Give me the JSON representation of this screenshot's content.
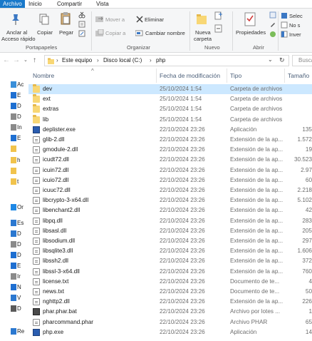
{
  "tabs": {
    "archivo": "Archivo",
    "inicio": "Inicio",
    "compartir": "Compartir",
    "vista": "Vista"
  },
  "ribbon": {
    "anclar": "Anclar al",
    "anclar2": "Acceso rápido",
    "copiar": "Copiar",
    "pegar": "Pegar",
    "mover_a": "Mover a",
    "copiar_a": "Copiar a",
    "eliminar": "Eliminar",
    "cambiar_nombre": "Cambiar nombre",
    "nueva": "Nueva",
    "carpeta": "carpeta",
    "propiedades": "Propiedades",
    "selec": "Selec",
    "no_s": "No s",
    "inver": "Inver",
    "groups": {
      "portapapeles": "Portapapeles",
      "organizar": "Organizar",
      "nuevo": "Nuevo",
      "abrir": "Abrir"
    }
  },
  "address": {
    "crumbs": [
      "Este equipo",
      "Disco local (C:)",
      "php"
    ],
    "search_placeholder": "Busca"
  },
  "nav": {
    "items": [
      {
        "label": "Ac",
        "color": "#3a8fd9"
      },
      {
        "label": "E",
        "color": "#1e6fd1"
      },
      {
        "label": "D",
        "color": "#1e6fd1"
      },
      {
        "label": "D",
        "color": "#8a8a8a"
      },
      {
        "label": "In",
        "color": "#8a8a8a"
      },
      {
        "label": "E",
        "color": "#1e6fd1"
      },
      {
        "label": "",
        "color": "#f1c34c"
      },
      {
        "label": "h",
        "color": "#f1c34c"
      },
      {
        "label": "",
        "color": "#f1c34c"
      },
      {
        "label": "t",
        "color": "#f1c34c"
      },
      {
        "label": "Or",
        "color": "#1e88e5"
      },
      {
        "label": "Es",
        "color": "#2b78d0"
      },
      {
        "label": "D",
        "color": "#2b78d0"
      },
      {
        "label": "D",
        "color": "#8a8a8a"
      },
      {
        "label": "D",
        "color": "#1e6fd1"
      },
      {
        "label": "E",
        "color": "#1e6fd1"
      },
      {
        "label": "Ir",
        "color": "#8a8a8a"
      },
      {
        "label": "N",
        "color": "#1e6fd1"
      },
      {
        "label": "V",
        "color": "#2b78d0"
      },
      {
        "label": "D",
        "color": "#5a5a5a"
      },
      {
        "label": "Re",
        "color": "#2b78d0"
      }
    ]
  },
  "columns": {
    "nombre": "Nombre",
    "fecha": "Fecha de modificación",
    "tipo": "Tipo",
    "tamano": "Tamaño"
  },
  "files": [
    {
      "name": "dev",
      "date": "25/10/2024 1:54",
      "type": "Carpeta de archivos",
      "size": "",
      "kind": "folder",
      "selected": true
    },
    {
      "name": "ext",
      "date": "25/10/2024 1:54",
      "type": "Carpeta de archivos",
      "size": "",
      "kind": "folder"
    },
    {
      "name": "extras",
      "date": "25/10/2024 1:54",
      "type": "Carpeta de archivos",
      "size": "",
      "kind": "folder"
    },
    {
      "name": "lib",
      "date": "25/10/2024 1:54",
      "type": "Carpeta de archivos",
      "size": "",
      "kind": "folder"
    },
    {
      "name": "deplister.exe",
      "date": "22/10/2024 23:26",
      "type": "Aplicación",
      "size": "135",
      "kind": "exe"
    },
    {
      "name": "glib-2.dll",
      "date": "22/10/2024 23:26",
      "type": "Extensión de la ap...",
      "size": "1.572",
      "kind": "file"
    },
    {
      "name": "gmodule-2.dll",
      "date": "22/10/2024 23:26",
      "type": "Extensión de la ap...",
      "size": "19",
      "kind": "file"
    },
    {
      "name": "icudt72.dll",
      "date": "22/10/2024 23:26",
      "type": "Extensión de la ap...",
      "size": "30.523",
      "kind": "file"
    },
    {
      "name": "icuin72.dll",
      "date": "22/10/2024 23:26",
      "type": "Extensión de la ap...",
      "size": "2.97",
      "kind": "file"
    },
    {
      "name": "icuio72.dll",
      "date": "22/10/2024 23:26",
      "type": "Extensión de la ap...",
      "size": "60",
      "kind": "file"
    },
    {
      "name": "icuuc72.dll",
      "date": "22/10/2024 23:26",
      "type": "Extensión de la ap...",
      "size": "2.218",
      "kind": "file"
    },
    {
      "name": "libcrypto-3-x64.dll",
      "date": "22/10/2024 23:26",
      "type": "Extensión de la ap...",
      "size": "5.102",
      "kind": "file"
    },
    {
      "name": "libenchant2.dll",
      "date": "22/10/2024 23:26",
      "type": "Extensión de la ap...",
      "size": "42",
      "kind": "file"
    },
    {
      "name": "libpq.dll",
      "date": "22/10/2024 23:26",
      "type": "Extensión de la ap...",
      "size": "283",
      "kind": "file"
    },
    {
      "name": "libsasl.dll",
      "date": "22/10/2024 23:26",
      "type": "Extensión de la ap...",
      "size": "205",
      "kind": "file"
    },
    {
      "name": "libsodium.dll",
      "date": "22/10/2024 23:26",
      "type": "Extensión de la ap...",
      "size": "297",
      "kind": "file"
    },
    {
      "name": "libsqlite3.dll",
      "date": "22/10/2024 23:26",
      "type": "Extensión de la ap...",
      "size": "1.606",
      "kind": "file"
    },
    {
      "name": "libssh2.dll",
      "date": "22/10/2024 23:26",
      "type": "Extensión de la ap...",
      "size": "372",
      "kind": "file"
    },
    {
      "name": "libssl-3-x64.dll",
      "date": "22/10/2024 23:26",
      "type": "Extensión de la ap...",
      "size": "760",
      "kind": "file"
    },
    {
      "name": "license.txt",
      "date": "22/10/2024 23:26",
      "type": "Documento de te...",
      "size": "4",
      "kind": "file"
    },
    {
      "name": "news.txt",
      "date": "22/10/2024 23:26",
      "type": "Documento de te...",
      "size": "50",
      "kind": "file"
    },
    {
      "name": "nghttp2.dll",
      "date": "22/10/2024 23:26",
      "type": "Extensión de la ap...",
      "size": "226",
      "kind": "file"
    },
    {
      "name": "phar.phar.bat",
      "date": "22/10/2024 23:26",
      "type": "Archivo por lotes ...",
      "size": "1",
      "kind": "bat"
    },
    {
      "name": "pharcommand.phar",
      "date": "22/10/2024 23:26",
      "type": "Archivo PHAR",
      "size": "65",
      "kind": "file"
    },
    {
      "name": "php.exe",
      "date": "22/10/2024 23:26",
      "type": "Aplicación",
      "size": "14",
      "kind": "exe"
    }
  ],
  "icons": {
    "pin": "pin-icon",
    "copy": "copy-icon",
    "paste": "paste-icon",
    "cut": "scissors-icon",
    "move": "move-to-icon",
    "delete": "delete-icon",
    "rename": "rename-icon",
    "new_folder": "new-folder-icon",
    "properties": "properties-icon"
  }
}
